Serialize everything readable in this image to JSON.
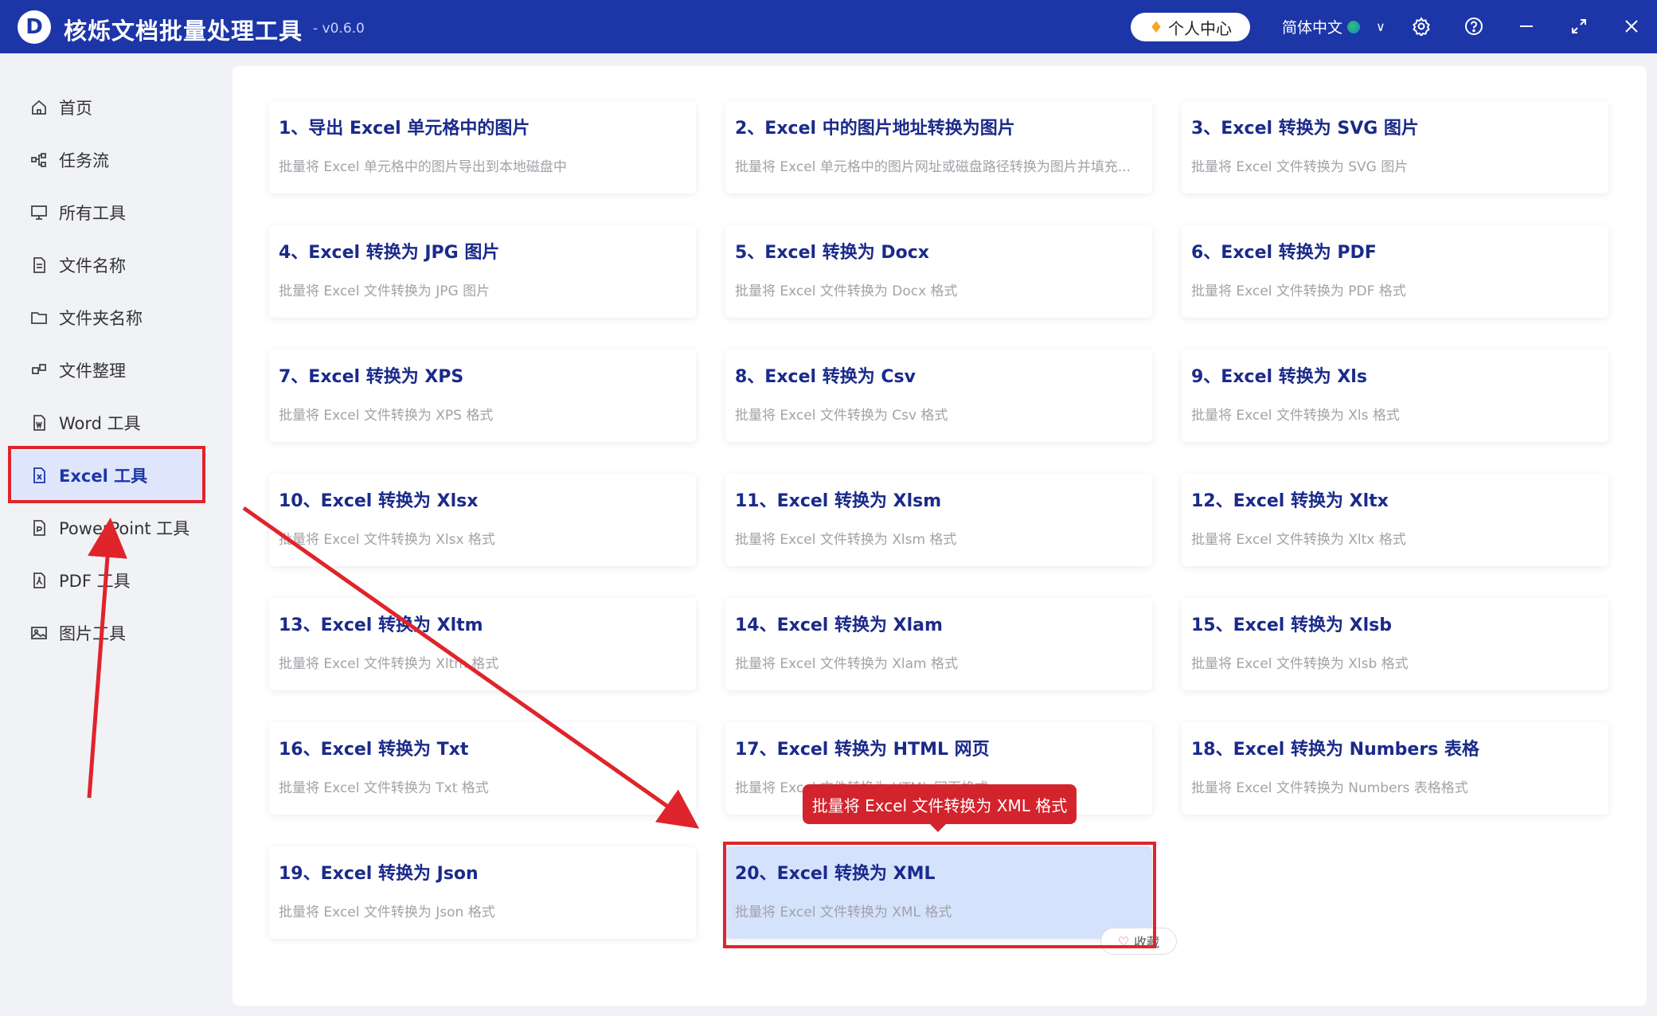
{
  "app": {
    "logo_letter": "D",
    "title": "核烁文档批量处理工具",
    "version": "- v0.6.0",
    "user_center": "个人中心",
    "language": "简体中文",
    "accent": "#1c36a8",
    "highlight": "#e0242c"
  },
  "sidebar": {
    "items": [
      {
        "label": "首页",
        "icon": "home-icon"
      },
      {
        "label": "任务流",
        "icon": "workflow-icon"
      },
      {
        "label": "所有工具",
        "icon": "monitor-icon"
      },
      {
        "label": "文件名称",
        "icon": "file-name-icon"
      },
      {
        "label": "文件夹名称",
        "icon": "folder-icon"
      },
      {
        "label": "文件整理",
        "icon": "organize-icon"
      },
      {
        "label": "Word 工具",
        "icon": "word-icon"
      },
      {
        "label": "Excel 工具",
        "icon": "excel-icon"
      },
      {
        "label": "PowerPoint 工具",
        "icon": "ppt-icon"
      },
      {
        "label": "PDF 工具",
        "icon": "pdf-icon"
      },
      {
        "label": "图片工具",
        "icon": "image-icon"
      }
    ],
    "active_index": 7
  },
  "tools": [
    {
      "title": "1、导出 Excel 单元格中的图片",
      "desc": "批量将 Excel 单元格中的图片导出到本地磁盘中"
    },
    {
      "title": "2、Excel 中的图片地址转换为图片",
      "desc": "批量将 Excel 单元格中的图片网址或磁盘路径转换为图片并填充..."
    },
    {
      "title": "3、Excel 转换为 SVG 图片",
      "desc": "批量将 Excel 文件转换为 SVG 图片"
    },
    {
      "title": "4、Excel 转换为 JPG 图片",
      "desc": "批量将 Excel 文件转换为 JPG 图片"
    },
    {
      "title": "5、Excel 转换为 Docx",
      "desc": "批量将 Excel 文件转换为 Docx 格式"
    },
    {
      "title": "6、Excel 转换为 PDF",
      "desc": "批量将 Excel 文件转换为 PDF 格式"
    },
    {
      "title": "7、Excel 转换为 XPS",
      "desc": "批量将 Excel 文件转换为 XPS 格式"
    },
    {
      "title": "8、Excel 转换为 Csv",
      "desc": "批量将 Excel 文件转换为 Csv 格式"
    },
    {
      "title": "9、Excel 转换为 Xls",
      "desc": "批量将 Excel 文件转换为 Xls 格式"
    },
    {
      "title": "10、Excel 转换为 Xlsx",
      "desc": "批量将 Excel 文件转换为 Xlsx 格式"
    },
    {
      "title": "11、Excel 转换为 Xlsm",
      "desc": "批量将 Excel 文件转换为 Xlsm 格式"
    },
    {
      "title": "12、Excel 转换为 Xltx",
      "desc": "批量将 Excel 文件转换为 Xltx 格式"
    },
    {
      "title": "13、Excel 转换为 Xltm",
      "desc": "批量将 Excel 文件转换为 Xltm 格式"
    },
    {
      "title": "14、Excel 转换为 Xlam",
      "desc": "批量将 Excel 文件转换为 Xlam 格式"
    },
    {
      "title": "15、Excel 转换为 Xlsb",
      "desc": "批量将 Excel 文件转换为 Xlsb 格式"
    },
    {
      "title": "16、Excel 转换为 Txt",
      "desc": "批量将 Excel 文件转换为 Txt 格式"
    },
    {
      "title": "17、Excel 转换为 HTML 网页",
      "desc": "批量将 Excel 文件转换为 HTML 网页格式"
    },
    {
      "title": "18、Excel 转换为 Numbers 表格",
      "desc": "批量将 Excel 文件转换为 Numbers 表格格式"
    },
    {
      "title": "19、Excel 转换为 Json",
      "desc": "批量将 Excel 文件转换为 Json 格式"
    },
    {
      "title": "20、Excel 转换为 XML",
      "desc": "批量将 Excel 文件转换为 XML 格式"
    }
  ],
  "selected_tool_index": 19,
  "tooltip": "批量将 Excel 文件转换为 XML 格式",
  "favorite_label": "收藏"
}
